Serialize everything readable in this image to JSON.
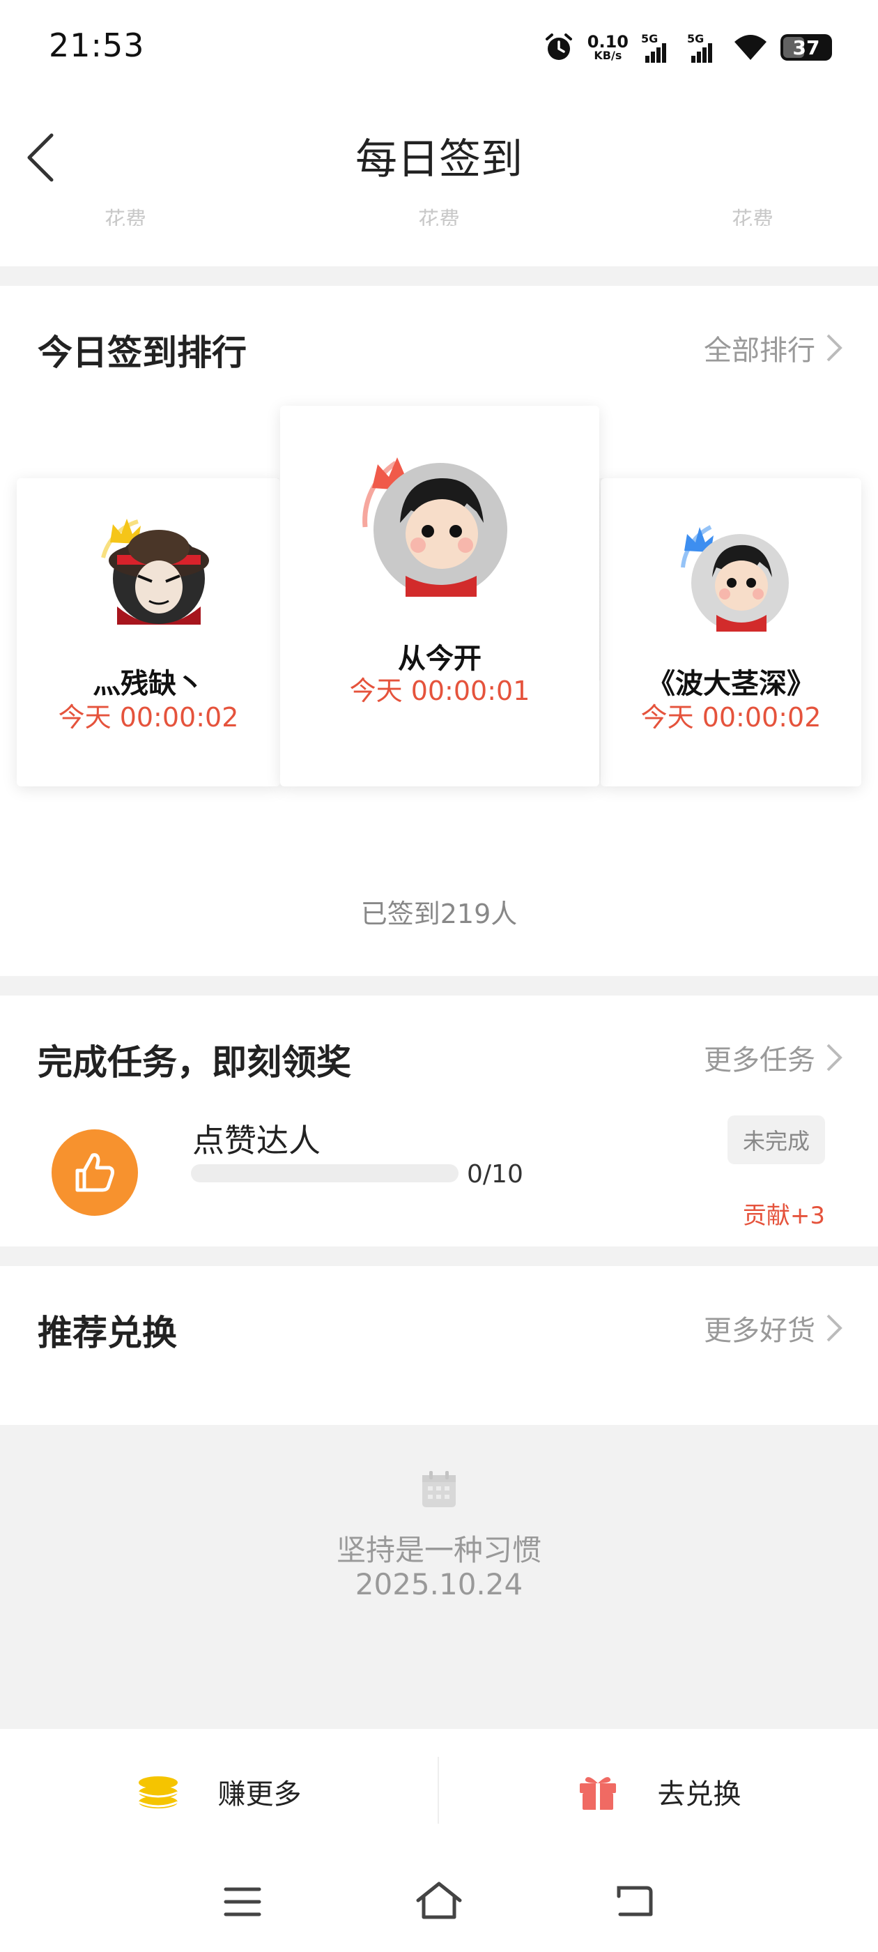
{
  "status_bar": {
    "time": "21:53",
    "net_speed_value": "0.10",
    "net_speed_unit": "KB/s",
    "signal1_label": "5G",
    "signal2_label": "5G",
    "battery": "37"
  },
  "header": {
    "title": "每日签到",
    "cut_labels": [
      "花费",
      "花费",
      "花费"
    ]
  },
  "ranking": {
    "title": "今日签到排行",
    "more_label": "全部排行",
    "entries": [
      {
        "rank": 2,
        "name": "灬残缺丶",
        "time": "今天 00:00:02",
        "crown_color": "#f5c518"
      },
      {
        "rank": 1,
        "name": "从今开",
        "time": "今天 00:00:01",
        "crown_color": "#f05a4a"
      },
      {
        "rank": 3,
        "name": "《波大茎深》",
        "time": "今天 00:00:02",
        "crown_color": "#3d8ef0"
      }
    ],
    "signed_count": "已签到219人"
  },
  "tasks": {
    "title": "完成任务，即刻领奖",
    "more_label": "更多任务",
    "items": [
      {
        "icon": "thumbs-up-icon",
        "name": "点赞达人",
        "progress_text": "0/10",
        "progress": 0,
        "status": "未完成",
        "reward": "贡献+3"
      }
    ]
  },
  "exchange": {
    "title": "推荐兑换",
    "more_label": "更多好货",
    "empty_line1": "坚持是一种习惯",
    "empty_line2": "2025.10.24"
  },
  "bottom_tabs": {
    "earn_label": "赚更多",
    "redeem_label": "去兑换"
  },
  "colors": {
    "accent_red": "#e5533c",
    "task_orange": "#f7922e",
    "coin_yellow": "#f5c400",
    "gift_red": "#f06a63"
  }
}
